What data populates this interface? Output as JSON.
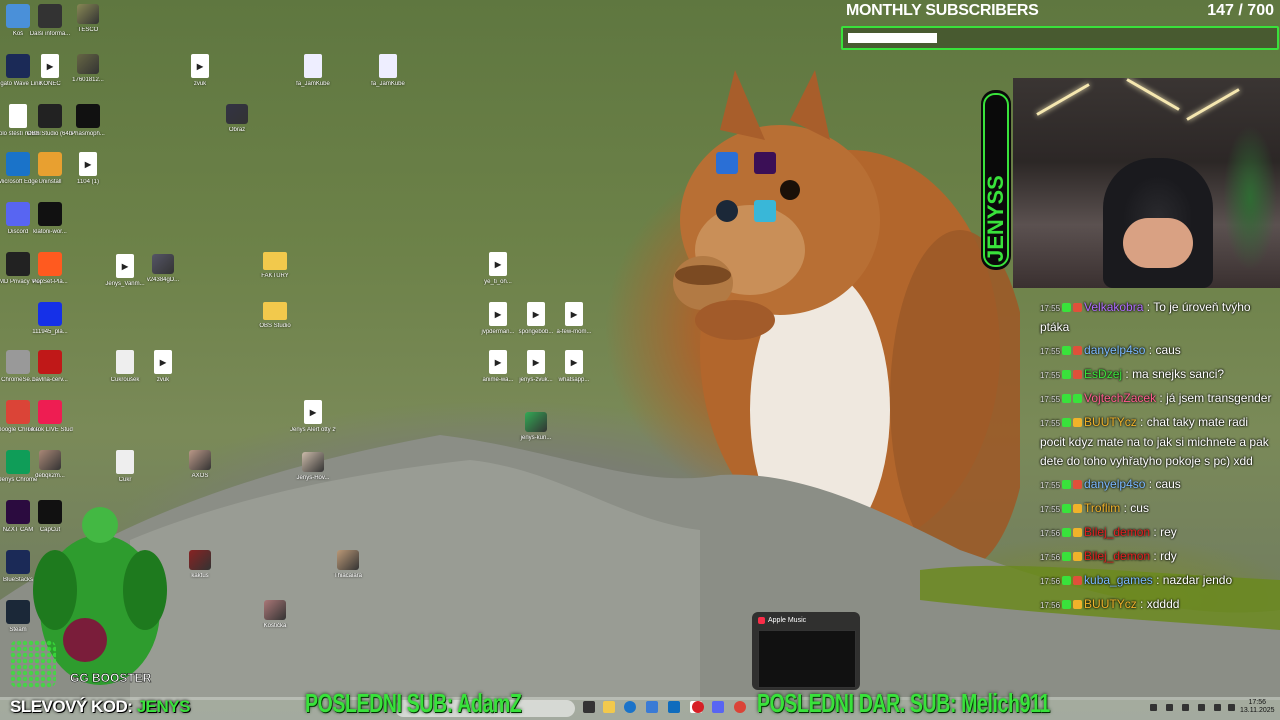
{
  "subscribers": {
    "title": "MONTHLY SUBSCRIBERS",
    "current": "147",
    "separator": "/",
    "goal": "700",
    "progress_fraction": 0.21
  },
  "desktop_icons": [
    {
      "label": "Koš",
      "icon": "recycle-bin-icon",
      "color": "#4a90d9"
    },
    {
      "label": "Další informa...",
      "icon": "info-icon",
      "color": "#333"
    },
    {
      "label": "TESCO",
      "icon": "image-icon",
      "color": "#885"
    },
    {
      "label": "Elgato Wave Link",
      "icon": "wave-icon",
      "color": "#1b2a57"
    },
    {
      "label": "KONEC",
      "icon": "media-icon",
      "color": "#fff"
    },
    {
      "label": "17601812...",
      "icon": "image-icon",
      "color": "#664"
    },
    {
      "label": "Kolo štěstí neštěstí.wh...",
      "icon": "document-icon",
      "color": "#fff"
    },
    {
      "label": "OBS Studio (64bit)",
      "icon": "obs-icon",
      "color": "#222"
    },
    {
      "label": "Phasmoph...",
      "icon": "game-icon",
      "color": "#111"
    },
    {
      "label": "Microsoft Edge",
      "icon": "edge-icon",
      "color": "#1a73c9"
    },
    {
      "label": "Uninstall",
      "icon": "uninstall-icon",
      "color": "#e8a030"
    },
    {
      "label": "1104 (1)",
      "icon": "media-icon",
      "color": "#fff"
    },
    {
      "label": "Discord",
      "icon": "discord-icon",
      "color": "#5865f2"
    },
    {
      "label": "klatoni-wor...",
      "icon": "keyboard-icon",
      "color": "#111"
    },
    {
      "label": "AMD Privacy View",
      "icon": "eye-icon",
      "color": "#222"
    },
    {
      "label": "PopSet-Pla...",
      "icon": "orange-icon",
      "color": "#ff5a1f"
    },
    {
      "label": "Jenys_Vanm...",
      "icon": "media-icon",
      "color": "#fff"
    },
    {
      "label": "v24384gD...",
      "icon": "image-icon",
      "color": "#556"
    },
    {
      "label": "111945_pla...",
      "icon": "blue-square-icon",
      "color": "#1530e8"
    },
    {
      "label": "ChromeSe...",
      "icon": "tools-icon",
      "color": "#999"
    },
    {
      "label": "bavlna-cerv...",
      "icon": "red-square-icon",
      "color": "#c01818"
    },
    {
      "label": "Cukroušek",
      "icon": "document-icon",
      "color": "#eee"
    },
    {
      "label": "zvuk",
      "icon": "media-icon",
      "color": "#fff"
    },
    {
      "label": "Google Chrome",
      "icon": "chrome-icon",
      "color": "#db4437"
    },
    {
      "label": "TikTok LIVE Studio",
      "icon": "tiktok-icon",
      "color": "#ee1d52"
    },
    {
      "label": "Jenys Chrome",
      "icon": "chrome-icon",
      "color": "#0f9d58"
    },
    {
      "label": "debqk2m...",
      "icon": "image-icon",
      "color": "#a87"
    },
    {
      "label": "Cukr",
      "icon": "document-icon",
      "color": "#eee"
    },
    {
      "label": "AXOS",
      "icon": "image-icon",
      "color": "#b98"
    },
    {
      "label": "NZXT CAM",
      "icon": "nzxt-icon",
      "color": "#2b0b3f"
    },
    {
      "label": "CapCut",
      "icon": "capcut-icon",
      "color": "#111"
    },
    {
      "label": "BlueStacks",
      "icon": "grid-icon",
      "color": "#1b2a57"
    },
    {
      "label": "kaktus",
      "icon": "image-icon",
      "color": "#822"
    },
    {
      "label": "Steam",
      "icon": "steam-icon",
      "color": "#1b2838"
    },
    {
      "label": "Kostička",
      "icon": "image-icon",
      "color": "#a77"
    },
    {
      "label": "Thiacaiara",
      "icon": "image-icon",
      "color": "#b97"
    },
    {
      "label": "zvuk",
      "icon": "media-icon",
      "color": "#fff"
    },
    {
      "label": "fa_JamKube",
      "icon": "document-icon",
      "color": "#eef"
    },
    {
      "label": "fa_JamKube",
      "icon": "document-icon",
      "color": "#eef"
    },
    {
      "label": "Obraz",
      "icon": "image-icon",
      "color": "#334"
    },
    {
      "label": "FAKTURY",
      "icon": "folder-icon",
      "color": "#f2c94c"
    },
    {
      "label": "OBS Studio",
      "icon": "folder-icon",
      "color": "#f2c94c"
    },
    {
      "label": "Jenys Alert otty zvuk",
      "icon": "media-icon",
      "color": "#fff"
    },
    {
      "label": "ye_ti_oh...",
      "icon": "media-icon",
      "color": "#fff"
    },
    {
      "label": "jvpderman...",
      "icon": "media-icon",
      "color": "#fff"
    },
    {
      "label": "spongebob...",
      "icon": "media-icon",
      "color": "#fff"
    },
    {
      "label": "a-few-mom...",
      "icon": "media-icon",
      "color": "#fff"
    },
    {
      "label": "anime-wa...",
      "icon": "media-icon",
      "color": "#fff"
    },
    {
      "label": "jenys-zvuk...",
      "icon": "media-icon",
      "color": "#fff"
    },
    {
      "label": "whatsapp...",
      "icon": "media-icon",
      "color": "#fff"
    },
    {
      "label": "jenys-kun...",
      "icon": "image-icon",
      "color": "#3a5"
    },
    {
      "label": "Jenys-Hov...",
      "icon": "image-icon",
      "color": "#cba"
    }
  ],
  "chat": [
    {
      "time": "17:55",
      "user": "Velkakobra",
      "user_color": "#b06cff",
      "text": "To je úroveň tvýho ptáka"
    },
    {
      "time": "17:55",
      "user": "danyelp4so",
      "user_color": "#7ab8ff",
      "text": "caus"
    },
    {
      "time": "17:55",
      "user": "EsDzej",
      "user_color": "#39e23b",
      "text": "ma snejks sanci?"
    },
    {
      "time": "17:55",
      "user": "VojtechZacek",
      "user_color": "#ff5d8f",
      "text": "já jsem transgender"
    },
    {
      "time": "17:55",
      "user": "BUUTYcz",
      "user_color": "#f0b22a",
      "text": "chat taky mate radi pocit kdyz mate na to jak si michnete a pak dete do toho vyhřatyho pokoje s pc) xdd"
    },
    {
      "time": "17:55",
      "user": "danyelp4so",
      "user_color": "#7ab8ff",
      "text": "caus"
    },
    {
      "time": "17:55",
      "user": "Troflim",
      "user_color": "#f0b22a",
      "text": "cus"
    },
    {
      "time": "17:56",
      "user": "Bilej_demon",
      "user_color": "#e02020",
      "text": "rey"
    },
    {
      "time": "17:56",
      "user": "Bilej_demon",
      "user_color": "#e02020",
      "text": "rdy"
    },
    {
      "time": "17:56",
      "user": "kuba_games",
      "user_color": "#7ab8ff",
      "text": "nazdar jendo"
    },
    {
      "time": "17:56",
      "user": "BUUTYcz",
      "user_color": "#f0b22a",
      "text": "xdddd"
    }
  ],
  "chat_separator": ":",
  "overlay": {
    "promo_label": "SLEVOVÝ KOD:",
    "promo_code": "JENYS",
    "last_sub": "POSLEDNI SUB: AdamZ",
    "last_gift_sub": "POSLEDNI DAR. SUB: Melich911",
    "brand_logo": "JENYSS",
    "sponsor_logo": "GG BOOSTER"
  },
  "apple_music": {
    "title": "Apple Music"
  },
  "clock": {
    "time": "17:56",
    "date": "13.11.2025"
  },
  "colors": {
    "accent_green": "#39e23b"
  }
}
